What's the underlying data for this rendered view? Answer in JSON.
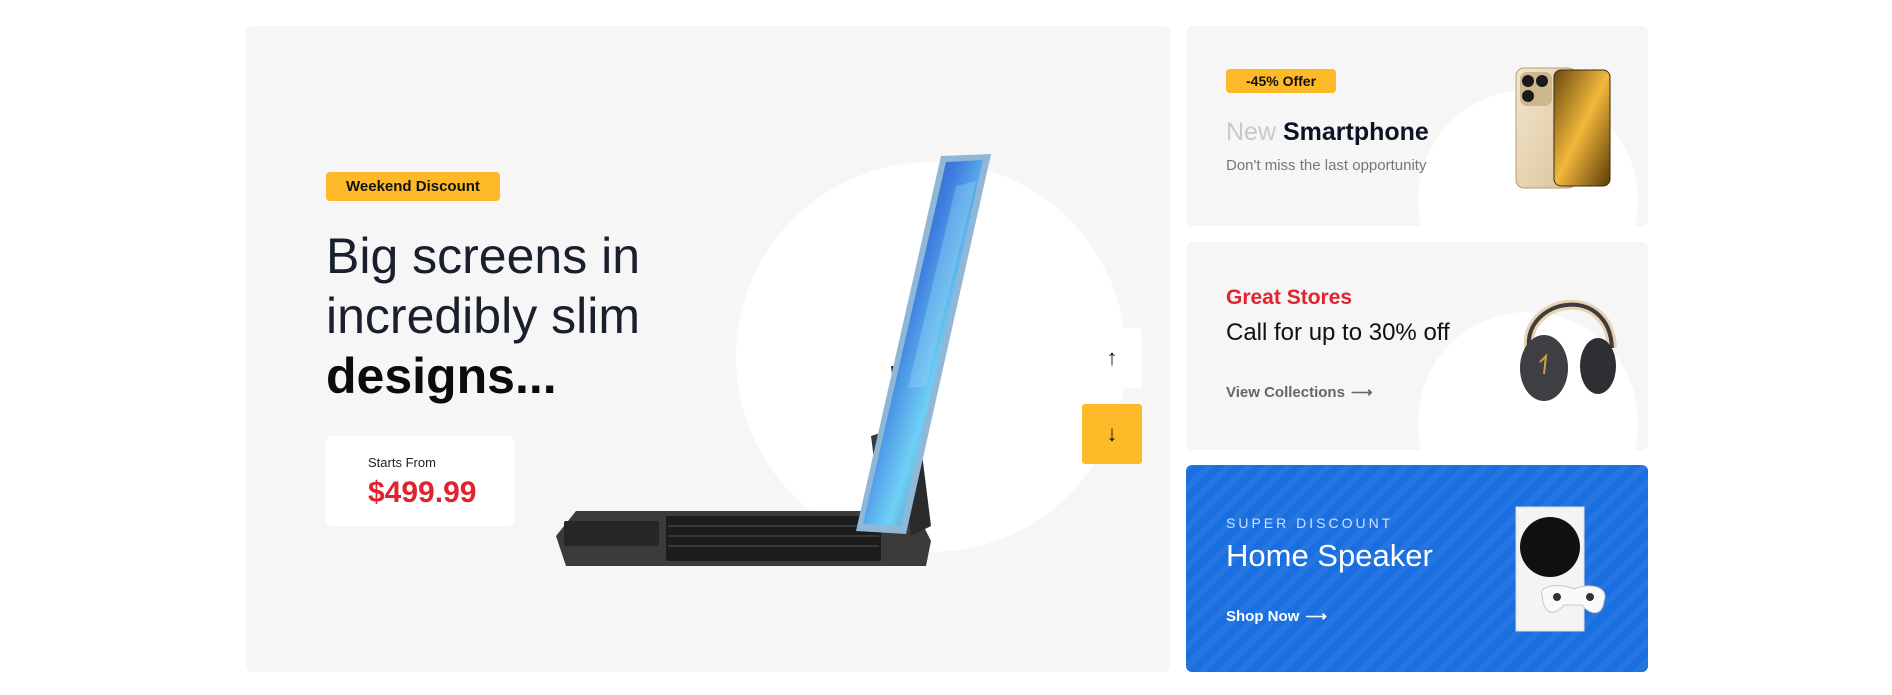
{
  "hero": {
    "badge": "Weekend Discount",
    "title_line1": "Big screens in",
    "title_line2": "incredibly slim",
    "title_bold": "designs...",
    "price_label": "Starts From",
    "price": "$499.99",
    "prev_arrow": "↑",
    "next_arrow": "↓"
  },
  "card1": {
    "badge": "-45% Offer",
    "title_light": "New",
    "title_strong": "Smartphone",
    "subtitle": "Don't miss the last opportunity"
  },
  "card2": {
    "kicker": "Great Stores",
    "title": "Call for up to 30% off",
    "link": "View Collections",
    "link_arrow": "⟶"
  },
  "card3": {
    "kicker": "SUPER DISCOUNT",
    "title": "Home Speaker",
    "link": "Shop Now",
    "link_arrow": "⟶"
  },
  "colors": {
    "accent_yellow": "#fdb927",
    "accent_red": "#e2232f",
    "blue_card": "#1a6fe0"
  },
  "icons": [
    "tablet-keyboard-image",
    "iphone-image",
    "headphones-image",
    "game-console-image",
    "arrow-up-icon",
    "arrow-down-icon",
    "arrow-right-icon"
  ]
}
